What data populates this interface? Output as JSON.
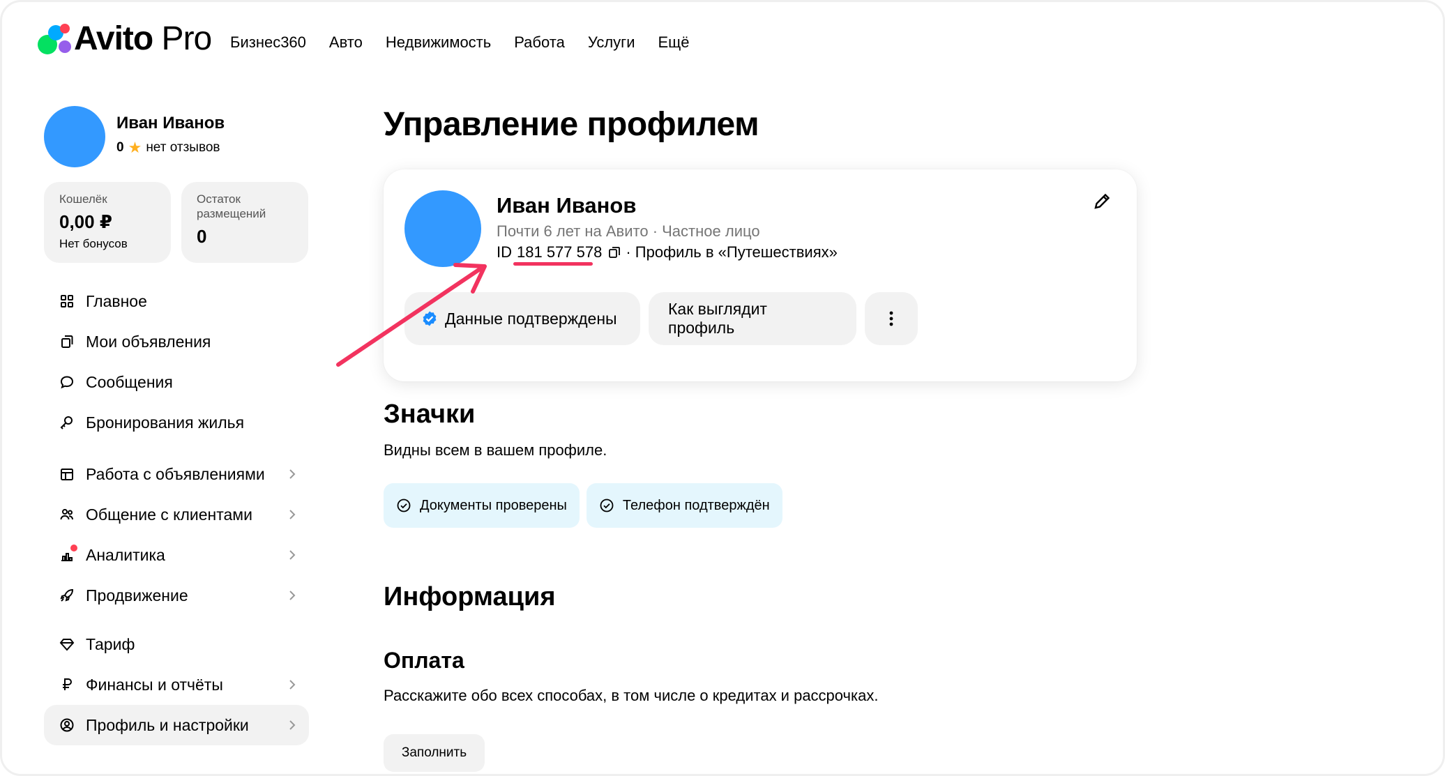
{
  "app": {
    "logo_main": "Avito",
    "logo_pro": " Pro",
    "nav": [
      "Бизнес360",
      "Авто",
      "Недвижимость",
      "Работа",
      "Услуги",
      "Ещё"
    ]
  },
  "sidebar": {
    "user_name": "Иван Иванов",
    "rating_value": "0",
    "rating_text": "нет отзывов",
    "wallet": {
      "label": "Кошелёк",
      "value": "0,00 ₽",
      "sub": "Нет бонусов"
    },
    "remaining": {
      "label": "Остаток размещений",
      "value": "0"
    },
    "items": [
      {
        "label": "Главное",
        "icon": "grid-icon"
      },
      {
        "label": "Мои объявления",
        "icon": "listings-icon"
      },
      {
        "label": "Сообщения",
        "icon": "chat-icon"
      },
      {
        "label": "Бронирования жилья",
        "icon": "booking-icon"
      },
      {
        "label": "Работа с объявлениями",
        "icon": "table-icon"
      },
      {
        "label": "Общение с клиентами",
        "icon": "clients-icon"
      },
      {
        "label": "Аналитика",
        "icon": "analytics-icon"
      },
      {
        "label": "Продвижение",
        "icon": "rocket-icon"
      },
      {
        "label": "Тариф",
        "icon": "diamond-icon"
      },
      {
        "label": "Финансы и отчёты",
        "icon": "ruble-icon"
      },
      {
        "label": "Профиль и настройки",
        "icon": "profile-icon"
      }
    ]
  },
  "main": {
    "title": "Управление профилем",
    "profile": {
      "name": "Иван Иванов",
      "meta": "Почти 6 лет на Авито · Частное лицо",
      "id_prefix": "ID",
      "id_value": "181 577 578",
      "id_suffix": "· Профиль в «Путешествиях»",
      "btn_verified": "Данные подтверждены",
      "btn_how": "Как выглядит профиль"
    },
    "badges": {
      "title": "Значки",
      "subtitle": "Видны всем в вашем профиле.",
      "items": [
        "Документы проверены",
        "Телефон подтверждён"
      ]
    },
    "info": {
      "title": "Информация",
      "payment_title": "Оплата",
      "payment_sub": "Расскажите обо всех способах, в том числе о кредитах и рассрочках.",
      "fill_btn": "Заполнить"
    }
  },
  "colors": {
    "avatar": "#3399ff",
    "accent_annotation": "#f2335f",
    "badge_bg": "#e4f6fd",
    "chip_bg": "#f2f2f2"
  }
}
